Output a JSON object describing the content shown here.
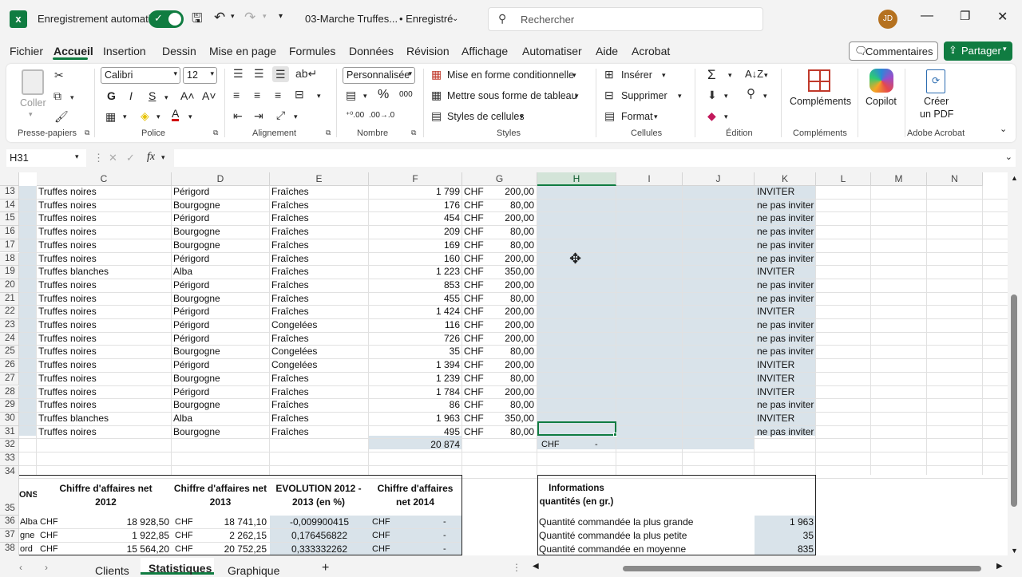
{
  "app": {
    "autosave_label": "Enregistrement automatique",
    "filename": "03-Marche Truffes...",
    "save_status": "• Enregistré",
    "search_placeholder": "Rechercher",
    "user_initials": "JD",
    "brand_color": "#107c41"
  },
  "menu": [
    "Fichier",
    "Accueil",
    "Insertion",
    "Dessin",
    "Mise en page",
    "Formules",
    "Données",
    "Révision",
    "Affichage",
    "Automatiser",
    "Aide",
    "Acrobat"
  ],
  "actions": {
    "comments": "Commentaires",
    "share": "Partager"
  },
  "ribbon": {
    "paste": "Coller",
    "font_name": "Calibri",
    "font_size": "12",
    "number_format": "Personnalisée",
    "cond_format": "Mise en forme conditionnelle",
    "table_format": "Mettre sous forme de tableau",
    "cell_styles": "Styles de cellules",
    "insert": "Insérer",
    "delete": "Supprimer",
    "format": "Format",
    "addins": "Compléments",
    "copilot": "Copilot",
    "create_pdf_1": "Créer",
    "create_pdf_2": "un PDF",
    "groups": [
      "Presse-papiers",
      "Police",
      "Alignement",
      "Nombre",
      "Styles",
      "Cellules",
      "Édition",
      "Compléments",
      "Adobe Acrobat"
    ]
  },
  "formula_bar": {
    "name_box": "H31",
    "fx": "fx"
  },
  "columns": [
    "C",
    "D",
    "E",
    "F",
    "G",
    "H",
    "I",
    "J",
    "K",
    "L",
    "M",
    "N"
  ],
  "rows": [
    {
      "n": "13",
      "c": "Truffes noires",
      "d": "Périgord",
      "e": "Fraîches",
      "f": "1 799",
      "cur": "CHF",
      "g": "200,00",
      "k": "INVITER"
    },
    {
      "n": "14",
      "c": "Truffes noires",
      "d": "Bourgogne",
      "e": "Fraîches",
      "f": "176",
      "cur": "CHF",
      "g": "80,00",
      "k": "ne pas inviter"
    },
    {
      "n": "15",
      "c": "Truffes noires",
      "d": "Périgord",
      "e": "Fraîches",
      "f": "454",
      "cur": "CHF",
      "g": "200,00",
      "k": "ne pas inviter"
    },
    {
      "n": "16",
      "c": "Truffes noires",
      "d": "Bourgogne",
      "e": "Fraîches",
      "f": "209",
      "cur": "CHF",
      "g": "80,00",
      "k": "ne pas inviter"
    },
    {
      "n": "17",
      "c": "Truffes noires",
      "d": "Bourgogne",
      "e": "Fraîches",
      "f": "169",
      "cur": "CHF",
      "g": "80,00",
      "k": "ne pas inviter"
    },
    {
      "n": "18",
      "c": "Truffes noires",
      "d": "Périgord",
      "e": "Fraîches",
      "f": "160",
      "cur": "CHF",
      "g": "200,00",
      "k": "ne pas inviter"
    },
    {
      "n": "19",
      "c": "Truffes blanches",
      "d": "Alba",
      "e": "Fraîches",
      "f": "1 223",
      "cur": "CHF",
      "g": "350,00",
      "k": "INVITER"
    },
    {
      "n": "20",
      "c": "Truffes noires",
      "d": "Périgord",
      "e": "Fraîches",
      "f": "853",
      "cur": "CHF",
      "g": "200,00",
      "k": "ne pas inviter"
    },
    {
      "n": "21",
      "c": "Truffes noires",
      "d": "Bourgogne",
      "e": "Fraîches",
      "f": "455",
      "cur": "CHF",
      "g": "80,00",
      "k": "ne pas inviter"
    },
    {
      "n": "22",
      "c": "Truffes noires",
      "d": "Périgord",
      "e": "Fraîches",
      "f": "1 424",
      "cur": "CHF",
      "g": "200,00",
      "k": "INVITER"
    },
    {
      "n": "23",
      "c": "Truffes noires",
      "d": "Périgord",
      "e": "Congelées",
      "f": "116",
      "cur": "CHF",
      "g": "200,00",
      "k": "ne pas inviter"
    },
    {
      "n": "24",
      "c": "Truffes noires",
      "d": "Périgord",
      "e": "Fraîches",
      "f": "726",
      "cur": "CHF",
      "g": "200,00",
      "k": "ne pas inviter"
    },
    {
      "n": "25",
      "c": "Truffes noires",
      "d": "Bourgogne",
      "e": "Congelées",
      "f": "35",
      "cur": "CHF",
      "g": "80,00",
      "k": "ne pas inviter"
    },
    {
      "n": "26",
      "c": "Truffes noires",
      "d": "Périgord",
      "e": "Congelées",
      "f": "1 394",
      "cur": "CHF",
      "g": "200,00",
      "k": "INVITER"
    },
    {
      "n": "27",
      "c": "Truffes noires",
      "d": "Bourgogne",
      "e": "Fraîches",
      "f": "1 239",
      "cur": "CHF",
      "g": "80,00",
      "k": "INVITER"
    },
    {
      "n": "28",
      "c": "Truffes noires",
      "d": "Périgord",
      "e": "Fraîches",
      "f": "1 784",
      "cur": "CHF",
      "g": "200,00",
      "k": "INVITER"
    },
    {
      "n": "29",
      "c": "Truffes noires",
      "d": "Bourgogne",
      "e": "Fraîches",
      "f": "86",
      "cur": "CHF",
      "g": "80,00",
      "k": "ne pas inviter"
    },
    {
      "n": "30",
      "c": "Truffes blanches",
      "d": "Alba",
      "e": "Fraîches",
      "f": "1 963",
      "cur": "CHF",
      "g": "350,00",
      "k": "INVITER"
    },
    {
      "n": "31",
      "c": "Truffes noires",
      "d": "Bourgogne",
      "e": "Fraîches",
      "f": "495",
      "cur": "CHF",
      "g": "80,00",
      "k": "ne pas inviter"
    }
  ],
  "row32": {
    "f": "20 874",
    "h_cur": "CHF",
    "h_val": "-"
  },
  "empty_rows": [
    "32",
    "33",
    "34"
  ],
  "stats": {
    "row_nums": [
      "35",
      "36",
      "37",
      "38"
    ],
    "col_b_head": "ONS",
    "head_c": "Chiffre d'affaires net 2012",
    "head_d": "Chiffre d'affaires net 2013",
    "head_e": "EVOLUTION 2012 - 2013 (en %)",
    "head_f": "Chiffre d'affaires net 2014",
    "rows": [
      {
        "b": "Alba",
        "c_cur": "CHF",
        "c": "18 928,50",
        "d_cur": "CHF",
        "d": "18 741,10",
        "e": "-0,009900415",
        "f_cur": "CHF",
        "f": "-"
      },
      {
        "b": "gne",
        "c_cur": "CHF",
        "c": "1 922,85",
        "d_cur": "CHF",
        "d": "2 262,15",
        "e": "0,176456822",
        "f_cur": "CHF",
        "f": "-"
      },
      {
        "b": "ord",
        "c_cur": "CHF",
        "c": "15 564,20",
        "d_cur": "CHF",
        "d": "20 752,25",
        "e": "0,333332262",
        "f_cur": "CHF",
        "f": "-"
      }
    ],
    "info_head": "Informations quantités (en gr.)",
    "info": [
      {
        "label": "Quantité commandée la plus grande",
        "value": "1 963"
      },
      {
        "label": "Quantité commandée la plus petite",
        "value": "35"
      },
      {
        "label": "Quantité commandée en moyenne",
        "value": "835"
      }
    ]
  },
  "tabs": [
    "Clients",
    "Statistiques",
    "Graphique"
  ],
  "active_tab": "Statistiques"
}
